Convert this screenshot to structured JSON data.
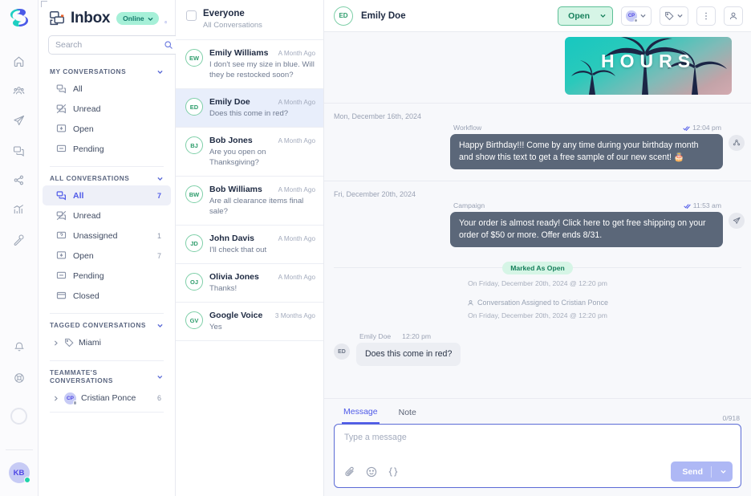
{
  "rail": {
    "logo": "brand-logo",
    "nav": [
      {
        "name": "home-icon"
      },
      {
        "name": "contacts-icon"
      },
      {
        "name": "campaigns-icon"
      },
      {
        "name": "inbox-icon"
      },
      {
        "name": "workflows-icon"
      },
      {
        "name": "analytics-icon"
      },
      {
        "name": "tools-icon"
      }
    ],
    "bottom": [
      {
        "name": "notifications-icon"
      },
      {
        "name": "help-support-icon"
      }
    ],
    "avatar_initials": "KB"
  },
  "sidebar": {
    "title": "Inbox",
    "status_label": "Online",
    "search_placeholder": "Search",
    "compose_label": "compose-icon",
    "sections": [
      {
        "title": "MY CONVERSATIONS",
        "items": [
          {
            "label": "All",
            "icon": "chats-icon",
            "count": "",
            "active": false
          },
          {
            "label": "Unread",
            "icon": "unread-icon",
            "count": "",
            "active": false
          },
          {
            "label": "Open",
            "icon": "open-icon",
            "count": "",
            "active": false
          },
          {
            "label": "Pending",
            "icon": "pending-icon",
            "count": "",
            "active": false
          }
        ]
      },
      {
        "title": "ALL CONVERSATIONS",
        "items": [
          {
            "label": "All",
            "icon": "chats-icon",
            "count": "7",
            "active": true
          },
          {
            "label": "Unread",
            "icon": "unread-icon",
            "count": "",
            "active": false
          },
          {
            "label": "Unassigned",
            "icon": "unassigned-icon",
            "count": "1",
            "active": false
          },
          {
            "label": "Open",
            "icon": "open-icon",
            "count": "7",
            "active": false
          },
          {
            "label": "Pending",
            "icon": "pending-icon",
            "count": "",
            "active": false
          },
          {
            "label": "Closed",
            "icon": "closed-icon",
            "count": "",
            "active": false
          }
        ]
      }
    ],
    "tagged": {
      "title": "TAGGED CONVERSATIONS",
      "items": [
        {
          "label": "Miami",
          "count": ""
        }
      ]
    },
    "teammates": {
      "title": "TEAMMATE'S CONVERSATIONS",
      "items": [
        {
          "label": "Cristian Ponce",
          "initials": "CP",
          "count": "6"
        }
      ]
    }
  },
  "list": {
    "header_title": "Everyone",
    "header_sub": "All Conversations",
    "conversations": [
      {
        "initials": "EW",
        "name": "Emily Williams",
        "time": "A Month Ago",
        "preview": "I don't see my size in blue. Will they be restocked soon?",
        "selected": false
      },
      {
        "initials": "ED",
        "name": "Emily Doe",
        "time": "A Month Ago",
        "preview": "Does this come in red?",
        "selected": true
      },
      {
        "initials": "BJ",
        "name": "Bob Jones",
        "time": "A Month Ago",
        "preview": "Are you open on Thanksgiving?",
        "selected": false
      },
      {
        "initials": "BW",
        "name": "Bob Williams",
        "time": "A Month Ago",
        "preview": "Are all clearance items final sale?",
        "selected": false
      },
      {
        "initials": "JD",
        "name": "John Davis",
        "time": "A Month Ago",
        "preview": "I'll check that out",
        "selected": false
      },
      {
        "initials": "OJ",
        "name": "Olivia Jones",
        "time": "A Month Ago",
        "preview": "Thanks!",
        "selected": false
      },
      {
        "initials": "GV",
        "name": "Google Voice",
        "time": "3 Months Ago",
        "preview": "Yes",
        "selected": false
      }
    ]
  },
  "thread": {
    "contact_initials": "ED",
    "contact_name": "Emily Doe",
    "status_button": "Open",
    "assignee_initials": "CP",
    "media_caption": "HOURS",
    "day_1": "Mon, December 16th, 2024",
    "msg_1": {
      "from": "Workflow",
      "time": "12:04 pm",
      "text": "Happy Birthday!!! Come by any time during your birthday month and show this text to get a free sample of our new scent! 🎂"
    },
    "day_2": "Fri, December 20th, 2024",
    "msg_2": {
      "from": "Campaign",
      "time": "11:53 am",
      "text": "Your order is almost ready! Click here to get free shipping on your order of $50 or more. Offer ends 8/31."
    },
    "marked_badge": "Marked As Open",
    "marked_sub": "On Friday, December 20th, 2024 @ 12:20 pm",
    "assigned_text": "Conversation Assigned to Cristian Ponce",
    "assigned_sub": "On Friday, December 20th, 2024 @ 12:20 pm",
    "msg_3": {
      "from": "Emily Doe",
      "time": "12:20 pm",
      "text": "Does this come in red?",
      "initials": "ED"
    }
  },
  "composer": {
    "tabs": [
      {
        "label": "Message",
        "active": true
      },
      {
        "label": "Note",
        "active": false
      }
    ],
    "counter": "0/918",
    "placeholder": "Type a message",
    "send_label": "Send",
    "tools": [
      "attachment-icon",
      "emoji-icon",
      "variable-icon"
    ]
  },
  "colors": {
    "accent": "#4f5ae8",
    "success": "#17805c",
    "success_bg": "#d6f5e6",
    "bubble_out": "#5b6779",
    "bubble_in": "#eceef3",
    "selected_row": "#e8eefb"
  }
}
